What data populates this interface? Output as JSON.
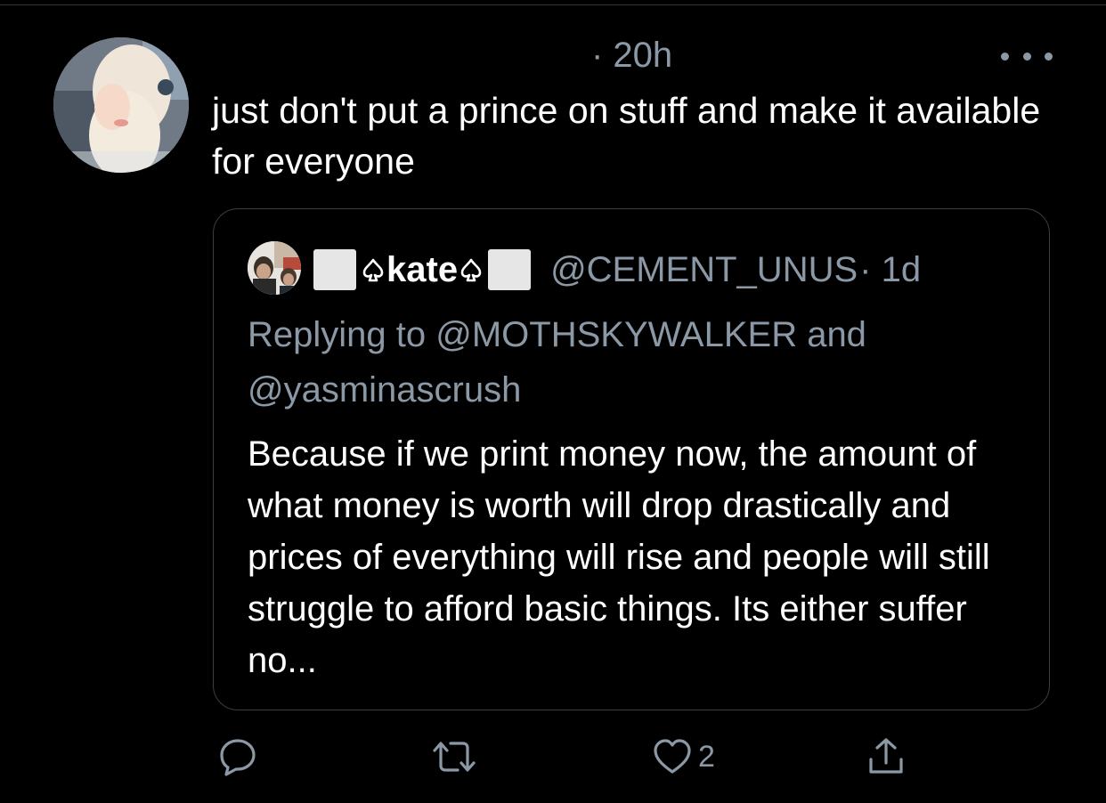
{
  "tweet": {
    "time": "· 20h",
    "text": "just don't put a prince on stuff and make it available for everyone"
  },
  "quoted": {
    "display_name": "kate",
    "handle": "@CEMENT_UNUS",
    "time": "· 1d",
    "reply_prefix": "Replying to ",
    "reply_user_1": "@MOTHSKYWALKER",
    "reply_and": " and ",
    "reply_user_2": "@yasminascrush",
    "text": "Because if we print money now, the amount of what money is worth will drop drastically and prices of everything will rise and people will still struggle to afford basic things. Its either suffer no..."
  },
  "actions": {
    "like_count": "2"
  },
  "colors": {
    "background": "#000000",
    "text_primary": "#ffffff",
    "text_secondary": "#8b98a5",
    "border": "#3a3f44"
  },
  "icons": [
    "more-icon",
    "reply-icon",
    "retweet-icon",
    "like-icon",
    "share-icon",
    "spade-icon"
  ]
}
